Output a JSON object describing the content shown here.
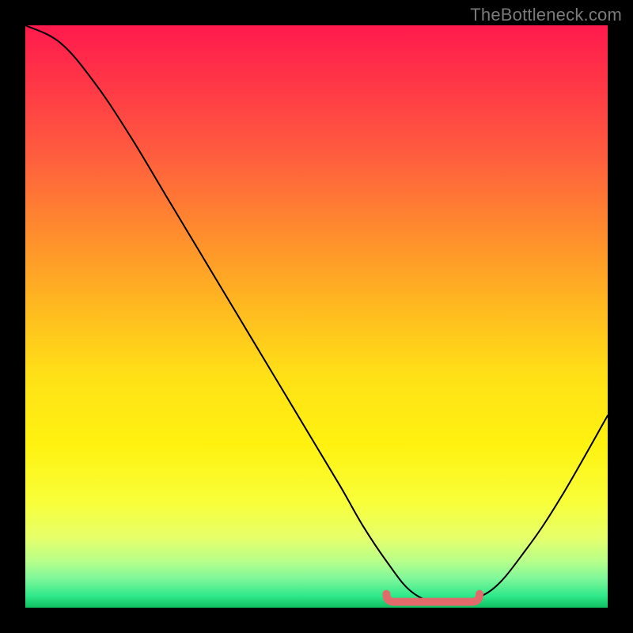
{
  "watermark": {
    "text": "TheBottleneck.com"
  },
  "chart_data": {
    "type": "line",
    "title": "",
    "xlabel": "",
    "ylabel": "",
    "xlim": [
      0,
      100
    ],
    "ylim": [
      0,
      100
    ],
    "x": [
      0,
      6,
      12,
      18,
      24,
      30,
      36,
      42,
      48,
      54,
      58,
      62,
      66,
      70,
      74,
      80,
      86,
      92,
      100
    ],
    "values": [
      100,
      97,
      90,
      81,
      71,
      61,
      51,
      41,
      31,
      21,
      14,
      8,
      3,
      1,
      1,
      3,
      10,
      19,
      33
    ],
    "flat_region": {
      "x_start": 62,
      "x_end": 78,
      "y": 1
    },
    "curve_color": "#000000",
    "marker_color": "#e26a6a",
    "grid": false,
    "legend": false
  }
}
